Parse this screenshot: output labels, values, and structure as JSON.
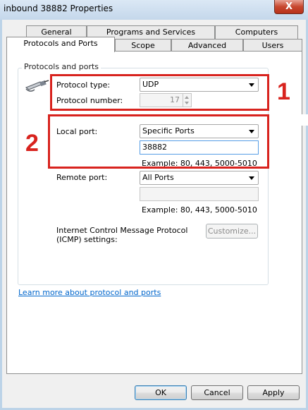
{
  "window": {
    "title": "inbound 38882 Properties",
    "close_symbol": "X"
  },
  "tabs": [
    {
      "label": "General"
    },
    {
      "label": "Programs and Services"
    },
    {
      "label": "Computers"
    },
    {
      "label": "Protocols and Ports"
    },
    {
      "label": "Scope"
    },
    {
      "label": "Advanced"
    },
    {
      "label": "Users"
    }
  ],
  "active_tab": "Protocols and Ports",
  "group": {
    "title": "Protocols and ports",
    "icon": "network-cable-icon",
    "protocol_type_label": "Protocol type:",
    "protocol_type_value": "UDP",
    "protocol_number_label": "Protocol number:",
    "protocol_number_value": "17",
    "local_port_label": "Local port:",
    "local_port_value": "Specific Ports",
    "local_port_input": "38882",
    "local_port_example": "Example: 80, 443, 5000-5010",
    "remote_port_label": "Remote port:",
    "remote_port_value": "All Ports",
    "remote_port_input": "",
    "remote_port_example": "Example: 80, 443, 5000-5010",
    "icmp_label_line1": "Internet Control Message Protocol",
    "icmp_label_line2": "(ICMP) settings:",
    "customize_label": "Customize..."
  },
  "learn_more_link": "Learn more about protocol and ports",
  "buttons": {
    "ok": "OK",
    "cancel": "Cancel",
    "apply": "Apply"
  },
  "annotations": {
    "one": "1",
    "two": "2",
    "color": "#d8231e"
  }
}
